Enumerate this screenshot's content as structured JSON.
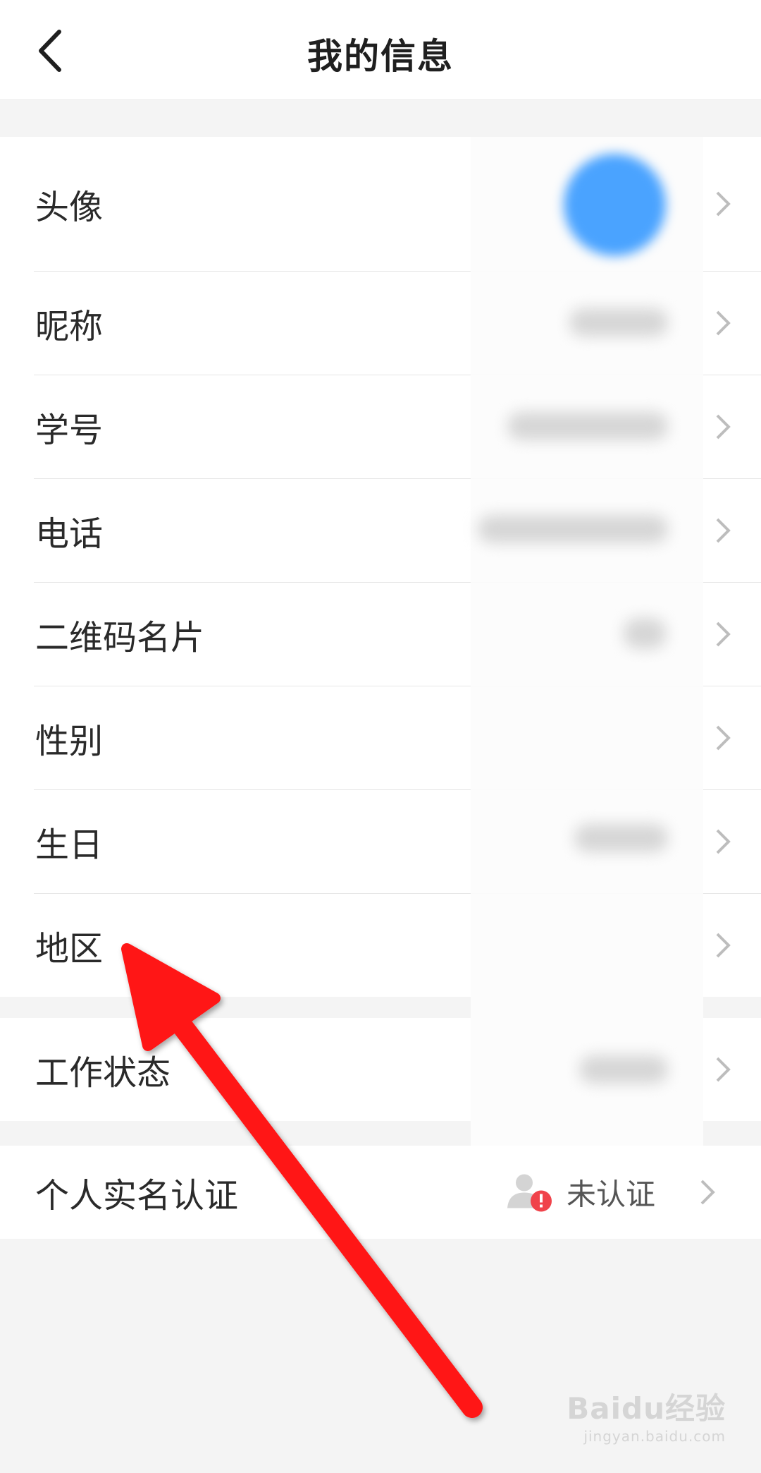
{
  "header": {
    "title": "我的信息",
    "back_icon": "chevron-left-icon"
  },
  "rows": [
    {
      "label": "头像"
    },
    {
      "label": "昵称"
    },
    {
      "label": "学号"
    },
    {
      "label": "电话"
    },
    {
      "label": "二维码名片"
    },
    {
      "label": "性别"
    },
    {
      "label": "生日"
    },
    {
      "label": "地区"
    }
  ],
  "work_status": {
    "label": "工作状态"
  },
  "verification": {
    "label": "个人实名认证",
    "status": "未认证"
  },
  "watermark": {
    "logo": "Baidu经验",
    "url": "jingyan.baidu.com"
  },
  "colors": {
    "avatar": "#4aa3ff",
    "arrow": "#ff1414",
    "alert": "#f0434b"
  }
}
